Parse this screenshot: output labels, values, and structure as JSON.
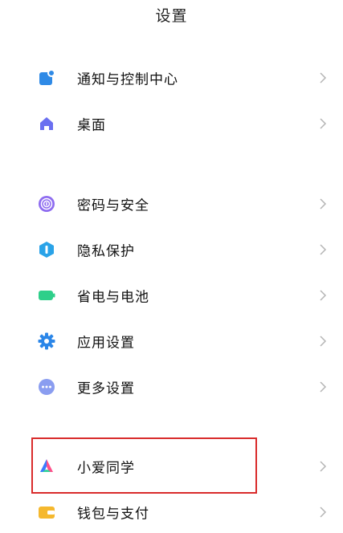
{
  "header": {
    "title": "设置"
  },
  "groups": [
    {
      "items": [
        {
          "label": "通知与控制中心",
          "icon": "notification-icon"
        },
        {
          "label": "桌面",
          "icon": "home-icon"
        }
      ]
    },
    {
      "items": [
        {
          "label": "密码与安全",
          "icon": "fingerprint-icon"
        },
        {
          "label": "隐私保护",
          "icon": "privacy-shield-icon"
        },
        {
          "label": "省电与电池",
          "icon": "battery-icon"
        },
        {
          "label": "应用设置",
          "icon": "gear-icon"
        },
        {
          "label": "更多设置",
          "icon": "more-dots-icon"
        }
      ]
    },
    {
      "items": [
        {
          "label": "小爱同学",
          "icon": "xiaoai-icon"
        },
        {
          "label": "钱包与支付",
          "icon": "wallet-icon"
        }
      ]
    }
  ],
  "highlight": {
    "target": "小爱同学",
    "color": "#d92b2b"
  }
}
